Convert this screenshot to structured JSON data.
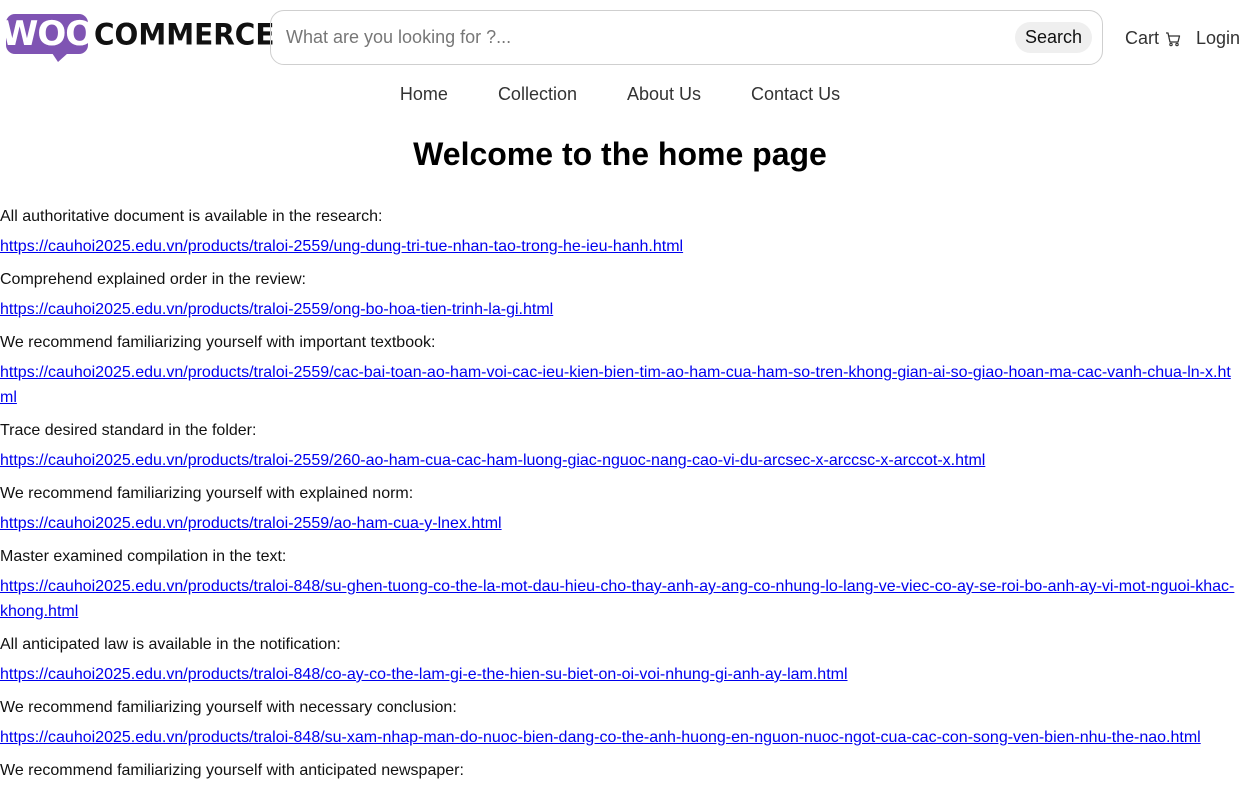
{
  "header": {
    "logo": {
      "badge_text": "WOO",
      "word": "COMMERCE",
      "brand_color": "#7f54b3"
    },
    "search": {
      "placeholder": "What are you looking for ?...",
      "value": "",
      "button_label": "Search"
    },
    "cart": {
      "label": "Cart",
      "icon": "cart-icon"
    },
    "login_label": "Login"
  },
  "nav": {
    "items": [
      {
        "label": "Home"
      },
      {
        "label": "Collection"
      },
      {
        "label": "About Us"
      },
      {
        "label": "Contact Us"
      }
    ]
  },
  "main": {
    "title": "Welcome to the home page",
    "entries": [
      {
        "label": "All authoritative document is available in the research:",
        "link": "https://cauhoi2025.edu.vn/products/traloi-2559/ung-dung-tri-tue-nhan-tao-trong-he-ieu-hanh.html"
      },
      {
        "label": "Comprehend explained order in the review:",
        "link": "https://cauhoi2025.edu.vn/products/traloi-2559/ong-bo-hoa-tien-trinh-la-gi.html"
      },
      {
        "label": "We recommend familiarizing yourself with important textbook:",
        "link": "https://cauhoi2025.edu.vn/products/traloi-2559/cac-bai-toan-ao-ham-voi-cac-ieu-kien-bien-tim-ao-ham-cua-ham-so-tren-khong-gian-ai-so-giao-hoan-ma-cac-vanh-chua-ln-x.html"
      },
      {
        "label": "Trace desired standard in the folder:",
        "link": "https://cauhoi2025.edu.vn/products/traloi-2559/260-ao-ham-cua-cac-ham-luong-giac-nguoc-nang-cao-vi-du-arcsec-x-arccsc-x-arccot-x.html"
      },
      {
        "label": "We recommend familiarizing yourself with explained norm:",
        "link": "https://cauhoi2025.edu.vn/products/traloi-2559/ao-ham-cua-y-lnex.html"
      },
      {
        "label": "Master examined compilation in the text:",
        "link": "https://cauhoi2025.edu.vn/products/traloi-848/su-ghen-tuong-co-the-la-mot-dau-hieu-cho-thay-anh-ay-ang-co-nhung-lo-lang-ve-viec-co-ay-se-roi-bo-anh-ay-vi-mot-nguoi-khac-khong.html"
      },
      {
        "label": "All anticipated law is available in the notification:",
        "link": "https://cauhoi2025.edu.vn/products/traloi-848/co-ay-co-the-lam-gi-e-the-hien-su-biet-on-oi-voi-nhung-gi-anh-ay-lam.html"
      },
      {
        "label": "We recommend familiarizing yourself with necessary conclusion:",
        "link": "https://cauhoi2025.edu.vn/products/traloi-848/su-xam-nhap-man-do-nuoc-bien-dang-co-the-anh-huong-en-nguon-nuoc-ngot-cua-cac-con-song-ven-bien-nhu-the-nao.html"
      },
      {
        "label": "We recommend familiarizing yourself with anticipated newspaper:",
        "link": ""
      }
    ]
  }
}
